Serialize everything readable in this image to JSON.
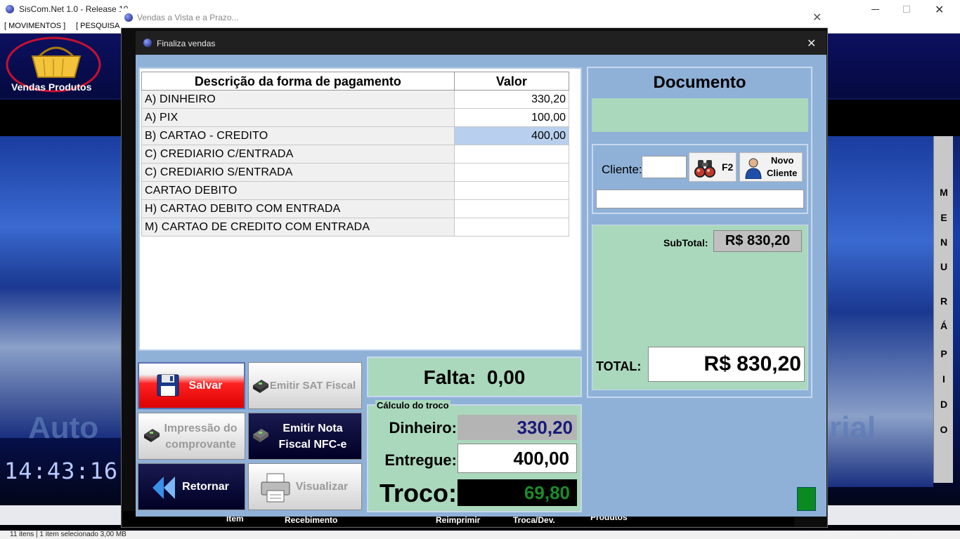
{
  "background_app": {
    "title": "SisCom.Net 1.0 - Release 10...",
    "menu": [
      "[ MOVIMENTOS ]",
      "[ PESQUISA"
    ],
    "vendas_label": "Vendas Produtos",
    "clock": "14:43:16",
    "watermark_left": "Auto",
    "watermark_right": "rial",
    "menu_rapido_letters": [
      "M",
      "E",
      "N",
      "U",
      "R",
      "Á",
      "P",
      "I",
      "D",
      "O"
    ],
    "bottom_buttons": [
      "Item",
      "Recebimento",
      "Reimprimir",
      "Troca/Dev.",
      "Produtos"
    ],
    "statusbar": "11 itens  |  1 item selecionado  3,00 MB"
  },
  "outer_window": {
    "title": "Vendas a Vista e a Prazo..."
  },
  "dialog": {
    "title": "Finaliza vendas",
    "close": "✕"
  },
  "payment_table": {
    "headers": [
      "Descrição da forma de pagamento",
      "Valor"
    ],
    "rows": [
      {
        "desc": "A) DINHEIRO",
        "value": "330,20"
      },
      {
        "desc": "A) PIX",
        "value": "100,00"
      },
      {
        "desc": "B) CARTAO - CREDITO",
        "value": "400,00"
      },
      {
        "desc": "C) CREDIARIO C/ENTRADA",
        "value": ""
      },
      {
        "desc": "C) CREDIARIO S/ENTRADA",
        "value": ""
      },
      {
        "desc": "CARTAO DEBITO",
        "value": ""
      },
      {
        "desc": "H) CARTAO DEBITO COM ENTRADA",
        "value": ""
      },
      {
        "desc": "M) CARTAO DE CREDITO COM ENTRADA",
        "value": ""
      }
    ]
  },
  "document": {
    "title": "Documento",
    "cliente_label": "Cliente:",
    "search_key": "F2",
    "novo_cliente_1": "Novo",
    "novo_cliente_2": "Cliente",
    "subtotal_label": "SubTotal:",
    "subtotal": "R$ 830,20",
    "total_label": "TOTAL:",
    "total": "R$ 830,20"
  },
  "actions": {
    "salvar": "Salvar",
    "emitir_sat": "Emitir SAT Fiscal",
    "impressao_1": "Impressão do",
    "impressao_2": "comprovante",
    "nfce_1": "Emitir Nota",
    "nfce_2": "Fiscal NFC-e",
    "retornar": "Retornar",
    "visualizar": "Visualizar"
  },
  "falta": {
    "label": "Falta:",
    "value": "0,00"
  },
  "troco": {
    "title": "Cálculo do troco",
    "dinheiro_label": "Dinheiro:",
    "dinheiro": "330,20",
    "entregue_label": "Entregue:",
    "entregue": "400,00",
    "troco_label": "Troco:",
    "troco": "69,80"
  },
  "colors": {
    "panel_bg": "#8fb1d8",
    "green_panel": "#aad8bc",
    "troco_green": "#1b8a2a",
    "selected_cell": "#b8d0ee"
  }
}
